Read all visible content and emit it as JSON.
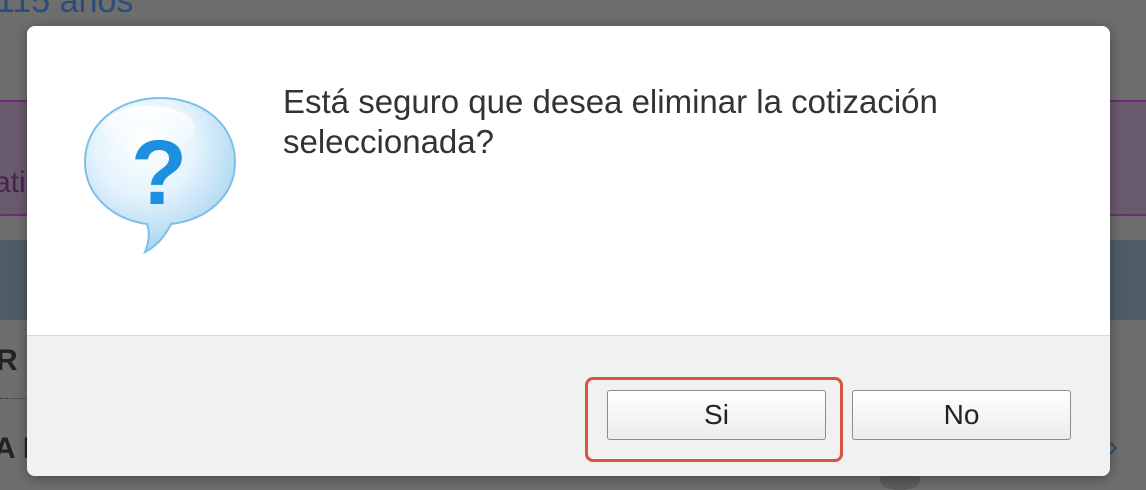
{
  "background": {
    "top_text": "115 años",
    "side_text": "ati",
    "row_r": "R",
    "row_a": "A I"
  },
  "dialog": {
    "icon": "question-bubble-icon",
    "message": "Está seguro que desea eliminar la cotización seleccionada?",
    "buttons": {
      "yes_label": "Si",
      "no_label": "No"
    },
    "highlight_color": "#d9533e"
  }
}
